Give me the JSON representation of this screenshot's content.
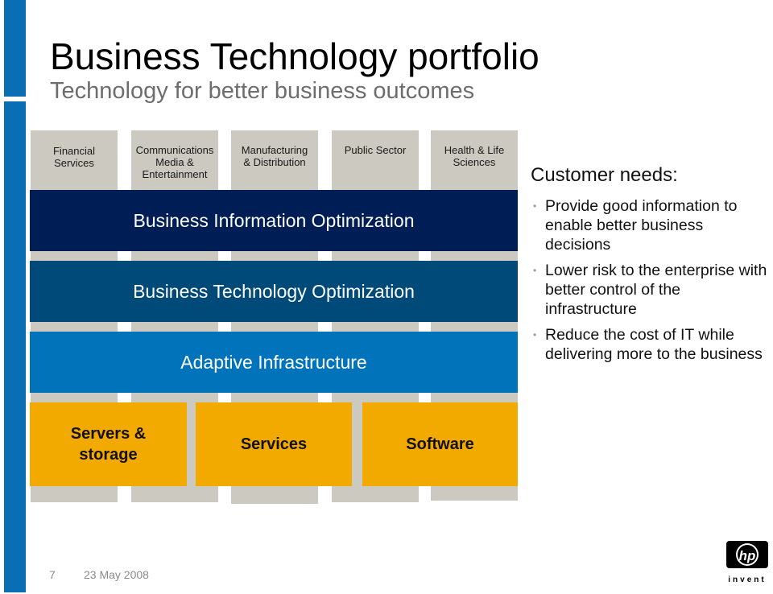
{
  "slide": {
    "title": "Business Technology portfolio",
    "subtitle": "Technology for better business outcomes"
  },
  "industries": [
    {
      "label": "Financial\nServices"
    },
    {
      "label": "Communications\nMedia &\nEntertainment"
    },
    {
      "label": "Manufacturing\n& Distribution"
    },
    {
      "label": "Public Sector"
    },
    {
      "label": "Health & Life\nSciences"
    }
  ],
  "layers": [
    {
      "label": "Business Information Optimization",
      "color": "#001e56"
    },
    {
      "label": "Business Technology Optimization",
      "color": "#004a79"
    },
    {
      "label": "Adaptive Infrastructure",
      "color": "#0073ba"
    }
  ],
  "products": [
    {
      "label": "Servers &\nstorage"
    },
    {
      "label": "Services"
    },
    {
      "label": "Software"
    }
  ],
  "customer_needs": {
    "title": "Customer needs:",
    "bullet_icon": "bullet-dot",
    "items": [
      "Provide good information to enable better business decisions",
      "Lower risk to the enterprise with better control of the infrastructure",
      "Reduce the cost of IT while delivering more to the business"
    ]
  },
  "footer": {
    "page_number": "7",
    "date": "23 May 2008"
  },
  "logo": {
    "mark": "hp",
    "tagline": "invent"
  },
  "colors": {
    "accent_blue": "#0a6eb4",
    "column_gray": "#cbc9c0",
    "product_orange": "#f2a900"
  }
}
